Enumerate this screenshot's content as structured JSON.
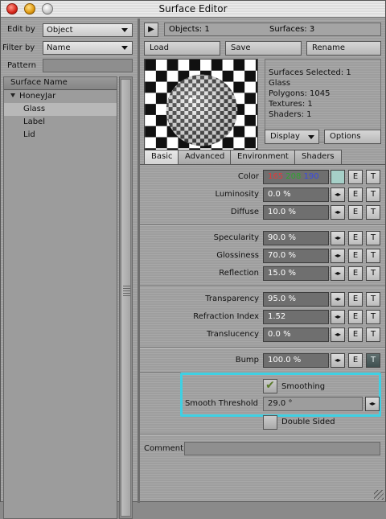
{
  "window": {
    "title": "Surface Editor"
  },
  "left": {
    "edit_by_label": "Edit by",
    "edit_by_value": "Object",
    "filter_by_label": "Filter by",
    "filter_by_value": "Name",
    "pattern_label": "Pattern",
    "pattern_value": "",
    "list_header": "Surface Name",
    "object_name": "HoneyJar",
    "surfaces": [
      "Glass",
      "Label",
      "Lid"
    ]
  },
  "right": {
    "objects": "Objects: 1",
    "surfaces_count": "Surfaces: 3",
    "load": "Load",
    "save": "Save",
    "rename": "Rename",
    "stats": [
      "Surfaces Selected: 1",
      "Glass",
      "Polygons: 1045",
      "Textures: 1",
      "Shaders: 1"
    ],
    "display": "Display",
    "options": "Options",
    "tabs": [
      "Basic",
      "Advanced",
      "Environment",
      "Shaders"
    ],
    "color_label": "Color",
    "color_r": "165",
    "color_g": "208",
    "color_b": "190",
    "params": [
      {
        "label": "Luminosity",
        "value": "0.0 %"
      },
      {
        "label": "Diffuse",
        "value": "10.0 %"
      },
      {
        "label": "Specularity",
        "value": "90.0 %"
      },
      {
        "label": "Glossiness",
        "value": "70.0 %"
      },
      {
        "label": "Reflection",
        "value": "15.0 %"
      },
      {
        "label": "Transparency",
        "value": "95.0 %"
      },
      {
        "label": "Refraction Index",
        "value": "1.52"
      },
      {
        "label": "Translucency",
        "value": "0.0 %"
      },
      {
        "label": "Bump",
        "value": "100.0 %"
      }
    ],
    "e_label": "E",
    "t_label": "T",
    "spin_label": "◂▸",
    "smoothing_label": "Smoothing",
    "smoothing_checked": "✔",
    "smooth_threshold_label": "Smooth Threshold",
    "smooth_threshold_value": "29.0 °",
    "double_sided_label": "Double Sided",
    "comment_label": "Comment",
    "comment_value": ""
  },
  "colors": {
    "highlight": "#3fd0e3",
    "swatch": "#a6d0c8",
    "value_field": "#6f6f6f"
  }
}
